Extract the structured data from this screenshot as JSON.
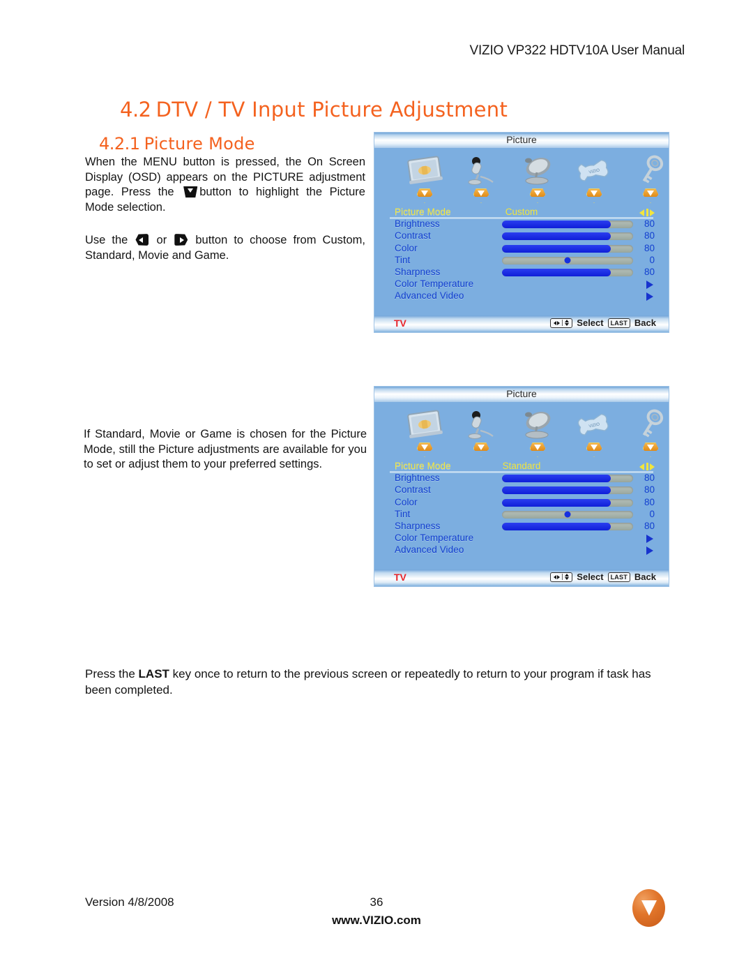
{
  "header": {
    "title": "VIZIO VP322 HDTV10A User Manual"
  },
  "headings": {
    "section_num": "4.2",
    "section_title": "DTV / TV Input Picture Adjustment",
    "sub_num": "4.2.1",
    "sub_title": "Picture Mode"
  },
  "paragraphs": {
    "p1_a": "When the MENU button is pressed, the On Screen Display (OSD) appears on the PICTURE adjustment page.  Press the ",
    "p1_b": "button to highlight the Picture Mode selection.",
    "p2_a": "Use the ",
    "p2_b": " or ",
    "p2_c": " button to choose from Custom, Standard, Movie and Game.",
    "p3": "If Standard, Movie or Game is chosen for the Picture Mode, still the Picture adjustments are available for you to set or adjust them to your preferred settings.",
    "p4_a": "Press the ",
    "p4_key": "LAST",
    "p4_b": " key once to return to the previous screen or repeatedly to return to your program if task has been completed."
  },
  "osd": {
    "title": "Picture",
    "icons": [
      {
        "name": "tv-screen-icon"
      },
      {
        "name": "microphone-icon"
      },
      {
        "name": "satellite-dish-icon"
      },
      {
        "name": "wrench-icon"
      },
      {
        "name": "key-icon"
      }
    ],
    "rows": [
      {
        "label": "Picture Mode",
        "type": "mode",
        "value": "Custom"
      },
      {
        "label": "Brightness",
        "type": "slider",
        "num": "80",
        "pct": 83
      },
      {
        "label": "Contrast",
        "type": "slider",
        "num": "80",
        "pct": 83
      },
      {
        "label": "Color",
        "type": "slider",
        "num": "80",
        "pct": 83
      },
      {
        "label": "Tint",
        "type": "knob",
        "num": "0",
        "pct": 50
      },
      {
        "label": "Sharpness",
        "type": "slider",
        "num": "80",
        "pct": 83
      },
      {
        "label": "Color Temperature",
        "type": "submenu"
      },
      {
        "label": "Advanced Video",
        "type": "submenu"
      }
    ],
    "status": {
      "source": "TV",
      "select_label": "Select",
      "last_key": "LAST",
      "back_label": "Back"
    },
    "mode_custom": "Custom",
    "mode_standard": "Standard"
  },
  "footer": {
    "version": "Version 4/8/2008",
    "page": "36",
    "url": "www.VIZIO.com",
    "logo": "vizio-v-logo"
  },
  "colors": {
    "brand_orange": "#F4621F",
    "osd_blue": "#7CAEE0",
    "osd_label_blue": "#123FCF",
    "osd_highlight_yellow": "#F2E53C",
    "osd_source_red": "#E8262B",
    "slider_fill": "#1A2EE0"
  }
}
